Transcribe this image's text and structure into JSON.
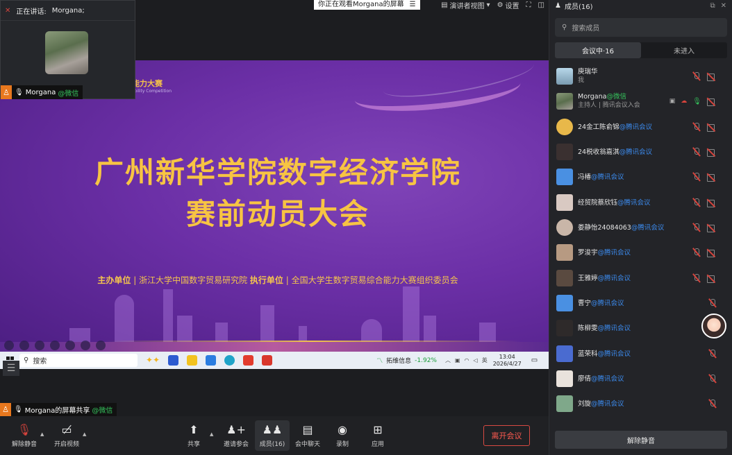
{
  "topbar": {
    "viewing_text": "你正在观看Morgana的屏幕",
    "presenter_view": "演讲者视图",
    "settings": "设置"
  },
  "speaker_popup": {
    "label": "正在讲话:",
    "name": "Morgana;",
    "tag_name": "Morgana",
    "tag_suffix": "@微信"
  },
  "slide": {
    "logo": "能力大赛",
    "logo_sub": "ability Competition",
    "title_line1": "广州新华学院数字经济学院",
    "title_line2": "赛前动员大会",
    "org_label1": "主办单位",
    "org_value1": "浙江大学中国数字贸易研究院",
    "org_label2": "执行单位",
    "org_value2": "全国大学生数字贸易综合能力大赛组织委员会"
  },
  "taskbar": {
    "search": "搜索",
    "stock_name": "拓维信息",
    "stock_change": "-1.92%",
    "time": "13:04",
    "date": "2026/4/27"
  },
  "sharer_tag": {
    "name": "Morgana的屏幕共享",
    "suffix": "@微信"
  },
  "toolbar": {
    "unmute": "解除静音",
    "start_video": "开启视频",
    "share": "共享",
    "invite": "邀请参会",
    "members": "成员(16)",
    "chat": "会中聊天",
    "record": "录制",
    "apps": "应用",
    "leave": "离开会议"
  },
  "panel": {
    "title": "成员(16)",
    "search_placeholder": "搜索成员",
    "tab_in_meeting": "会议中·16",
    "tab_not_joined": "未进入",
    "unmute_all": "解除静音",
    "members": [
      {
        "name": "庾瑞华",
        "suffix": "",
        "sub": "我",
        "avatar": "#8fb7c9"
      },
      {
        "name": "Morgana",
        "suffix": "@微信",
        "sub": "主持人 | 腾讯会议入会",
        "avatar": "#7d8a6d"
      },
      {
        "name": "24金工陈俞锦",
        "suffix": "@腾讯会议",
        "sub": "",
        "avatar": "#e8b84a"
      },
      {
        "name": "24税收翁嘉淇",
        "suffix": "@腾讯会议",
        "sub": "",
        "avatar": "#3a3030"
      },
      {
        "name": "冯椿",
        "suffix": "@腾讯会议",
        "sub": "",
        "avatar": "#4a90e2"
      },
      {
        "name": "经贸院蔡欣钰",
        "suffix": "@腾讯会议",
        "sub": "",
        "avatar": "#d9c9c2"
      },
      {
        "name": "娄静怡24084063",
        "suffix": "@腾讯会议",
        "sub": "",
        "avatar": "#c9b6a8"
      },
      {
        "name": "罗浚宇",
        "suffix": "@腾讯会议",
        "sub": "",
        "avatar": "#b79a82"
      },
      {
        "name": "王雅婷",
        "suffix": "@腾讯会议",
        "sub": "",
        "avatar": "#5a4a40"
      },
      {
        "name": "曹宁",
        "suffix": "@腾讯会议",
        "sub": "",
        "avatar": "#4a90e2"
      },
      {
        "name": "陈柳雯",
        "suffix": "@腾讯会议",
        "sub": "",
        "avatar": "#2e2a2a"
      },
      {
        "name": "蓝荣科",
        "suffix": "@腾讯会议",
        "sub": "",
        "avatar": "#4a6bd0"
      },
      {
        "name": "廖倩",
        "suffix": "@腾讯会议",
        "sub": "",
        "avatar": "#e9e2dc"
      },
      {
        "name": "刘旋",
        "suffix": "@腾讯会议",
        "sub": "",
        "avatar": "#7fa88a"
      }
    ]
  }
}
